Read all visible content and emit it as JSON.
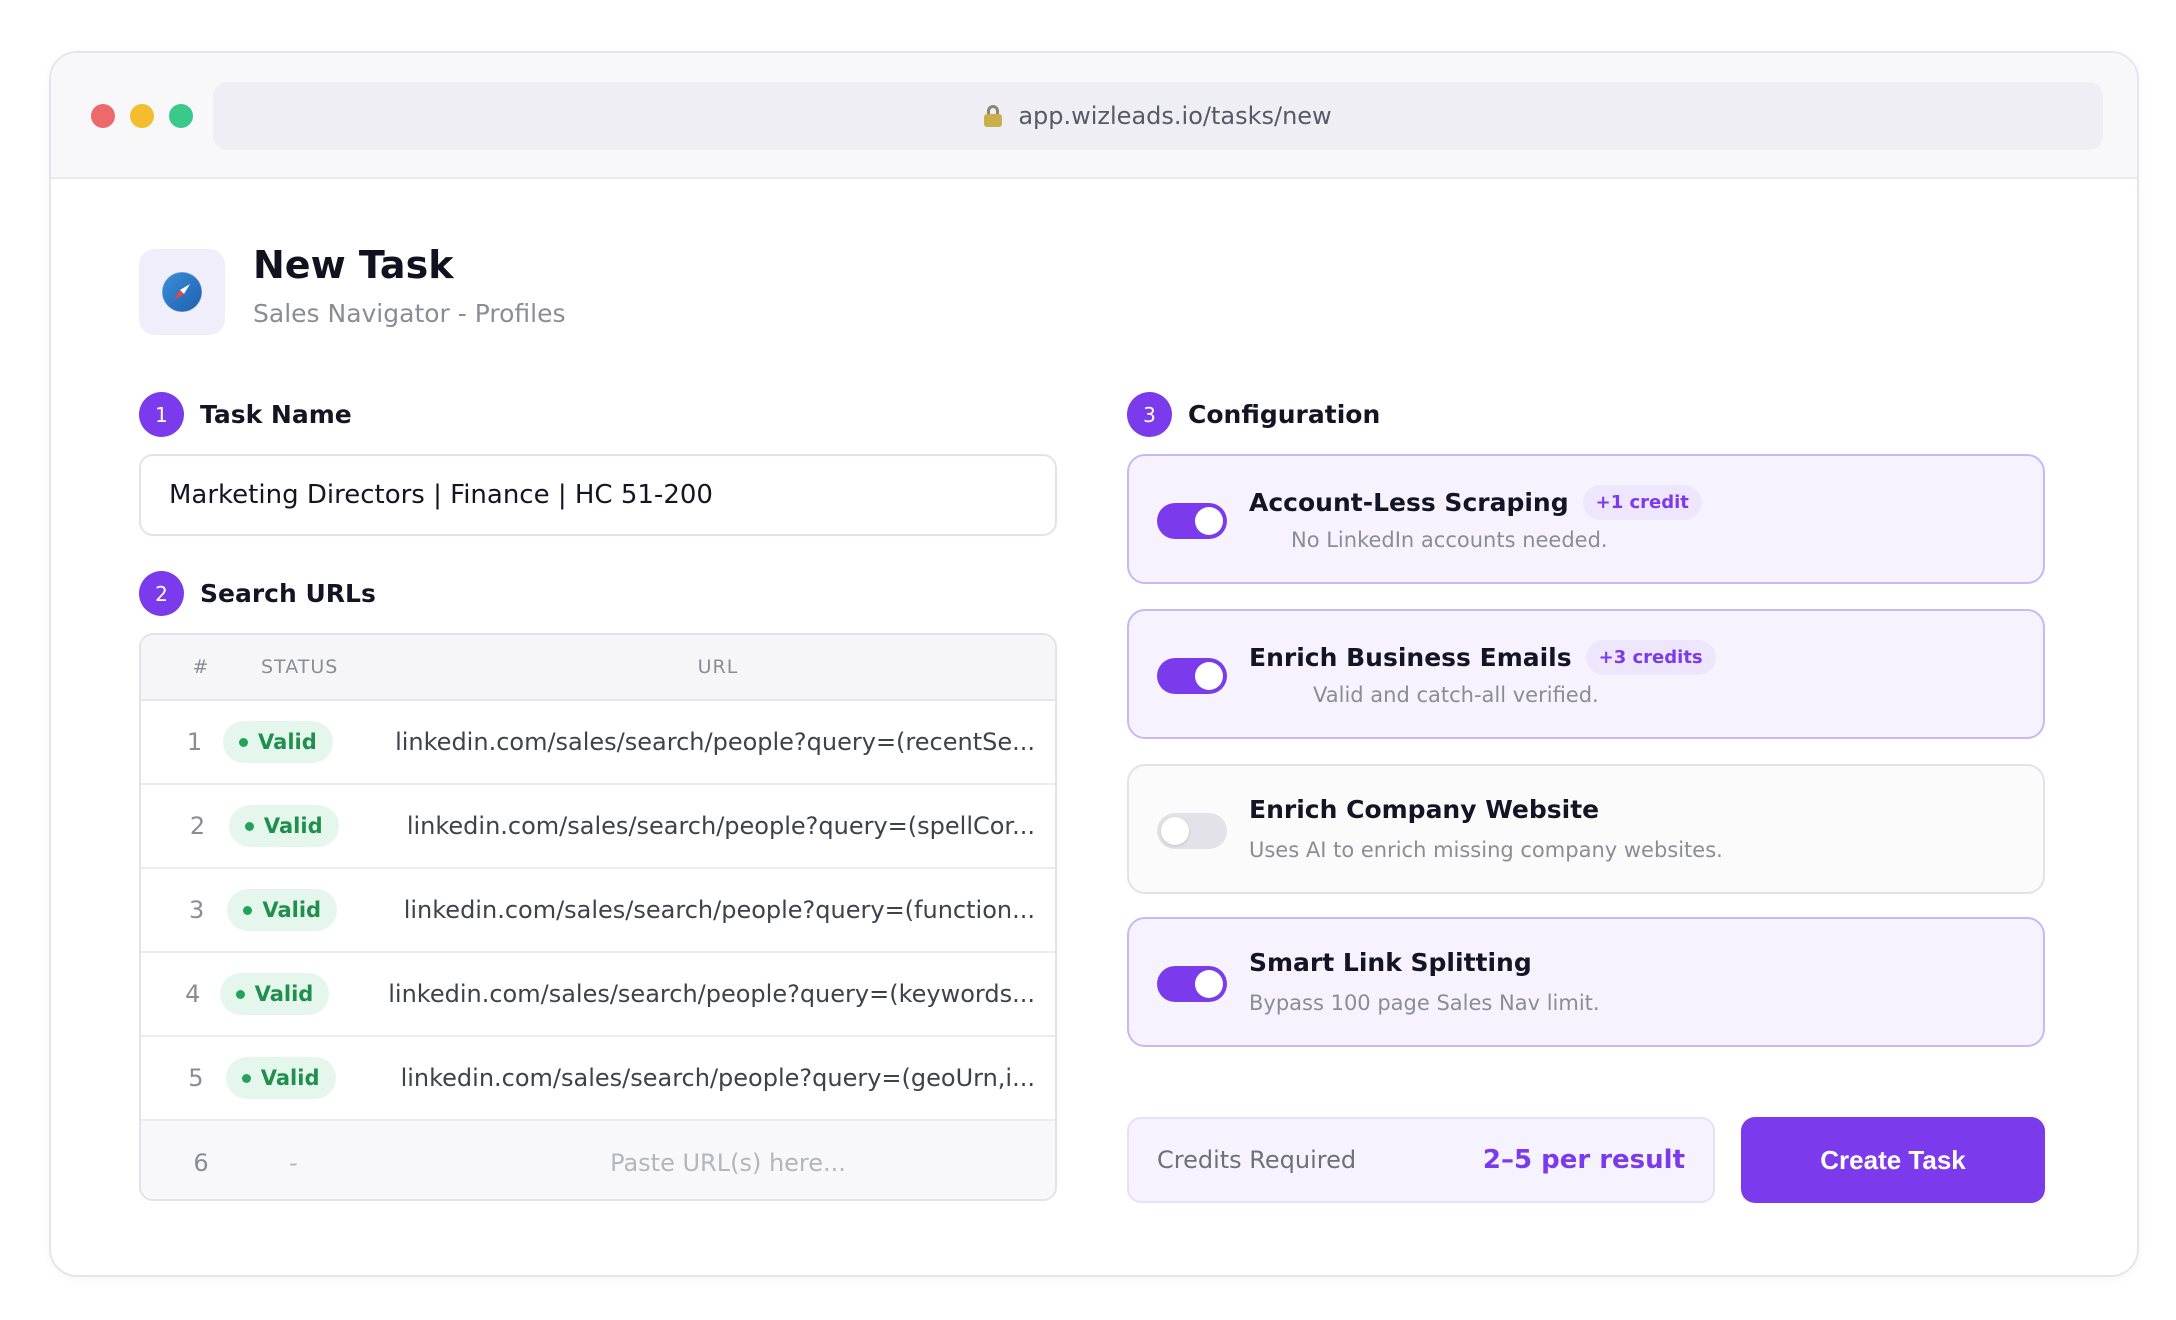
{
  "browser": {
    "url": "app.wizleads.io/tasks/new"
  },
  "header": {
    "title": "New Task",
    "subtitle": "Sales Navigator - Profiles",
    "icon": "compass-icon"
  },
  "steps": {
    "task_name": {
      "number": "1",
      "label": "Task Name",
      "value": "Marketing Directors | Finance | HC 51-200"
    },
    "search_urls": {
      "number": "2",
      "label": "Search URLs"
    },
    "configuration": {
      "number": "3",
      "label": "Configuration"
    }
  },
  "url_table": {
    "headers": {
      "num": "#",
      "status": "STATUS",
      "url": "URL"
    },
    "rows": [
      {
        "num": "1",
        "status": "Valid",
        "url": "linkedin.com/sales/search/people?query=(recentSe..."
      },
      {
        "num": "2",
        "status": "Valid",
        "url": "linkedin.com/sales/search/people?query=(spellCor..."
      },
      {
        "num": "3",
        "status": "Valid",
        "url": "linkedin.com/sales/search/people?query=(function..."
      },
      {
        "num": "4",
        "status": "Valid",
        "url": "linkedin.com/sales/search/people?query=(keywords..."
      },
      {
        "num": "5",
        "status": "Valid",
        "url": "linkedin.com/sales/search/people?query=(geoUrn,i..."
      }
    ],
    "empty_row": {
      "num": "6",
      "status": "-",
      "placeholder": "Paste URL(s) here..."
    }
  },
  "configuration": [
    {
      "title": "Account-Less Scraping",
      "credit": "+1 credit",
      "description": "No LinkedIn accounts needed.",
      "enabled": true
    },
    {
      "title": "Enrich Business Emails",
      "credit": "+3 credits",
      "description": "Valid and catch-all verified.",
      "enabled": true
    },
    {
      "title": "Enrich Company Website",
      "credit": "",
      "description": "Uses AI to enrich missing company websites.",
      "enabled": false
    },
    {
      "title": "Smart Link Splitting",
      "credit": "",
      "description": "Bypass 100 page Sales Nav limit.",
      "enabled": true
    }
  ],
  "footer": {
    "credits_label": "Credits Required",
    "credits_value": "2–5 per result",
    "create_button": "Create Task"
  },
  "colors": {
    "accent": "#7c3aed",
    "valid_green": "#1f8f4e"
  }
}
